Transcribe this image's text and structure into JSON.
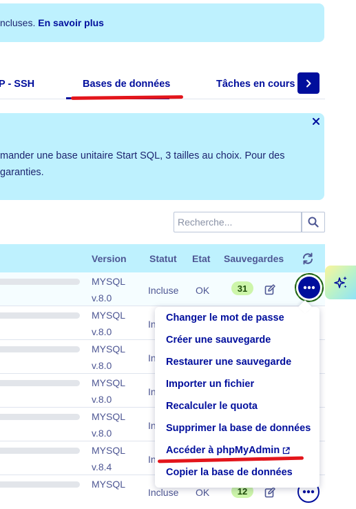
{
  "banner": {
    "text": "ncluses. ",
    "link": "En savoir plus"
  },
  "tabs": [
    {
      "label": "P - SSH",
      "active": false
    },
    {
      "label": "Bases de données",
      "active": true
    },
    {
      "label": "Tâches en cours",
      "active": false
    }
  ],
  "info": {
    "line1": "mander une base unitaire Start SQL, 3 tailles au choix. Pour des",
    "line2": "garanties."
  },
  "search": {
    "placeholder": "Recherche..."
  },
  "table": {
    "headers": {
      "version": "Version",
      "status": "Statut",
      "state": "Etat",
      "backups": "Sauvegardes"
    },
    "rows": [
      {
        "engine": "MYSQL",
        "version": "v.8.0",
        "status": "Incluse",
        "state": "OK",
        "backups": "31"
      },
      {
        "engine": "MYSQL",
        "version": "v.8.0",
        "status": "In",
        "state": "",
        "backups": ""
      },
      {
        "engine": "MYSQL",
        "version": "v.8.0",
        "status": "In",
        "state": "",
        "backups": ""
      },
      {
        "engine": "MYSQL",
        "version": "v.8.0",
        "status": "In",
        "state": "",
        "backups": ""
      },
      {
        "engine": "MYSQL",
        "version": "v.8.0",
        "status": "In",
        "state": "",
        "backups": ""
      },
      {
        "engine": "MYSQL",
        "version": "v.8.4",
        "status": "In",
        "state": "",
        "backups": ""
      },
      {
        "engine": "MYSQL",
        "version": "",
        "status": "Incluse",
        "state": "OK",
        "backups": "12"
      }
    ]
  },
  "menu": {
    "items": [
      "Changer le mot de passe",
      "Créer une sauvegarde",
      "Restaurer une sauvegarde",
      "Importer un fichier",
      "Recalculer le quota",
      "Supprimer la base de données",
      "Accéder à phpMyAdmin",
      "Copier la base de données"
    ]
  },
  "colors": {
    "primary": "#000e9c",
    "banner_bg": "#bef1fe",
    "text": "#4d5693",
    "badge_bg": "#cdf5aa",
    "annotation_red": "#e3151b"
  },
  "icons": {
    "next": "chevron-right-icon",
    "close": "close-icon",
    "search": "search-icon",
    "refresh": "refresh-icon",
    "edit": "edit-icon",
    "more": "ellipsis-icon",
    "external": "external-link-icon",
    "assistant": "sparkle-icon"
  }
}
